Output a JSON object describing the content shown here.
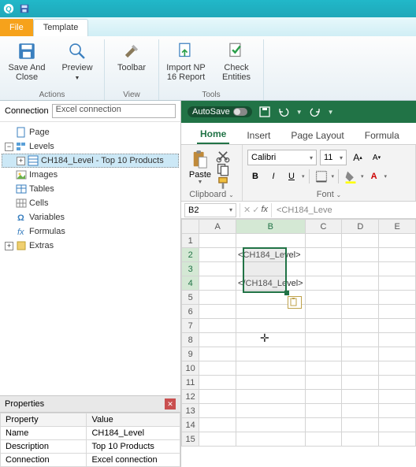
{
  "titlebar": {},
  "tabs": {
    "file": "File",
    "template": "Template"
  },
  "ribbon": {
    "save_close": "Save And\nClose",
    "preview": "Preview",
    "toolbar": "Toolbar",
    "import": "Import NP\n16 Report",
    "check": "Check\nEntities",
    "group_actions": "Actions",
    "group_view": "View",
    "group_tools": "Tools"
  },
  "connection": {
    "label": "Connection",
    "value": "Excel connection"
  },
  "tree": {
    "page": "Page",
    "levels": "Levels",
    "level1": "CH184_Level - Top 10 Products",
    "images": "Images",
    "tables": "Tables",
    "cells": "Cells",
    "variables": "Variables",
    "formulas": "Formulas",
    "extras": "Extras"
  },
  "props": {
    "title": "Properties",
    "h1": "Property",
    "h2": "Value",
    "r1k": "Name",
    "r1v": "CH184_Level",
    "r2k": "Description",
    "r2v": "Top 10 Products",
    "r3k": "Connection",
    "r3v": "Excel connection"
  },
  "excel": {
    "autosave": "AutoSave",
    "tabs": {
      "home": "Home",
      "insert": "Insert",
      "pagelayout": "Page Layout",
      "formula": "Formula"
    },
    "clipboard_label": "Clipboard",
    "paste": "Paste",
    "font_label": "Font",
    "font_name": "Calibri",
    "font_size": "11",
    "namebox": "B2",
    "fx": "fx",
    "formula_content": "<CH184_Leve",
    "cols": [
      "A",
      "B",
      "C",
      "D",
      "E"
    ],
    "rows": [
      "1",
      "2",
      "3",
      "4",
      "5",
      "6",
      "7",
      "8",
      "9",
      "10",
      "11",
      "12",
      "13",
      "14",
      "15"
    ],
    "b2": "<CH184_Level>",
    "b4": "</CH184_Level>"
  }
}
